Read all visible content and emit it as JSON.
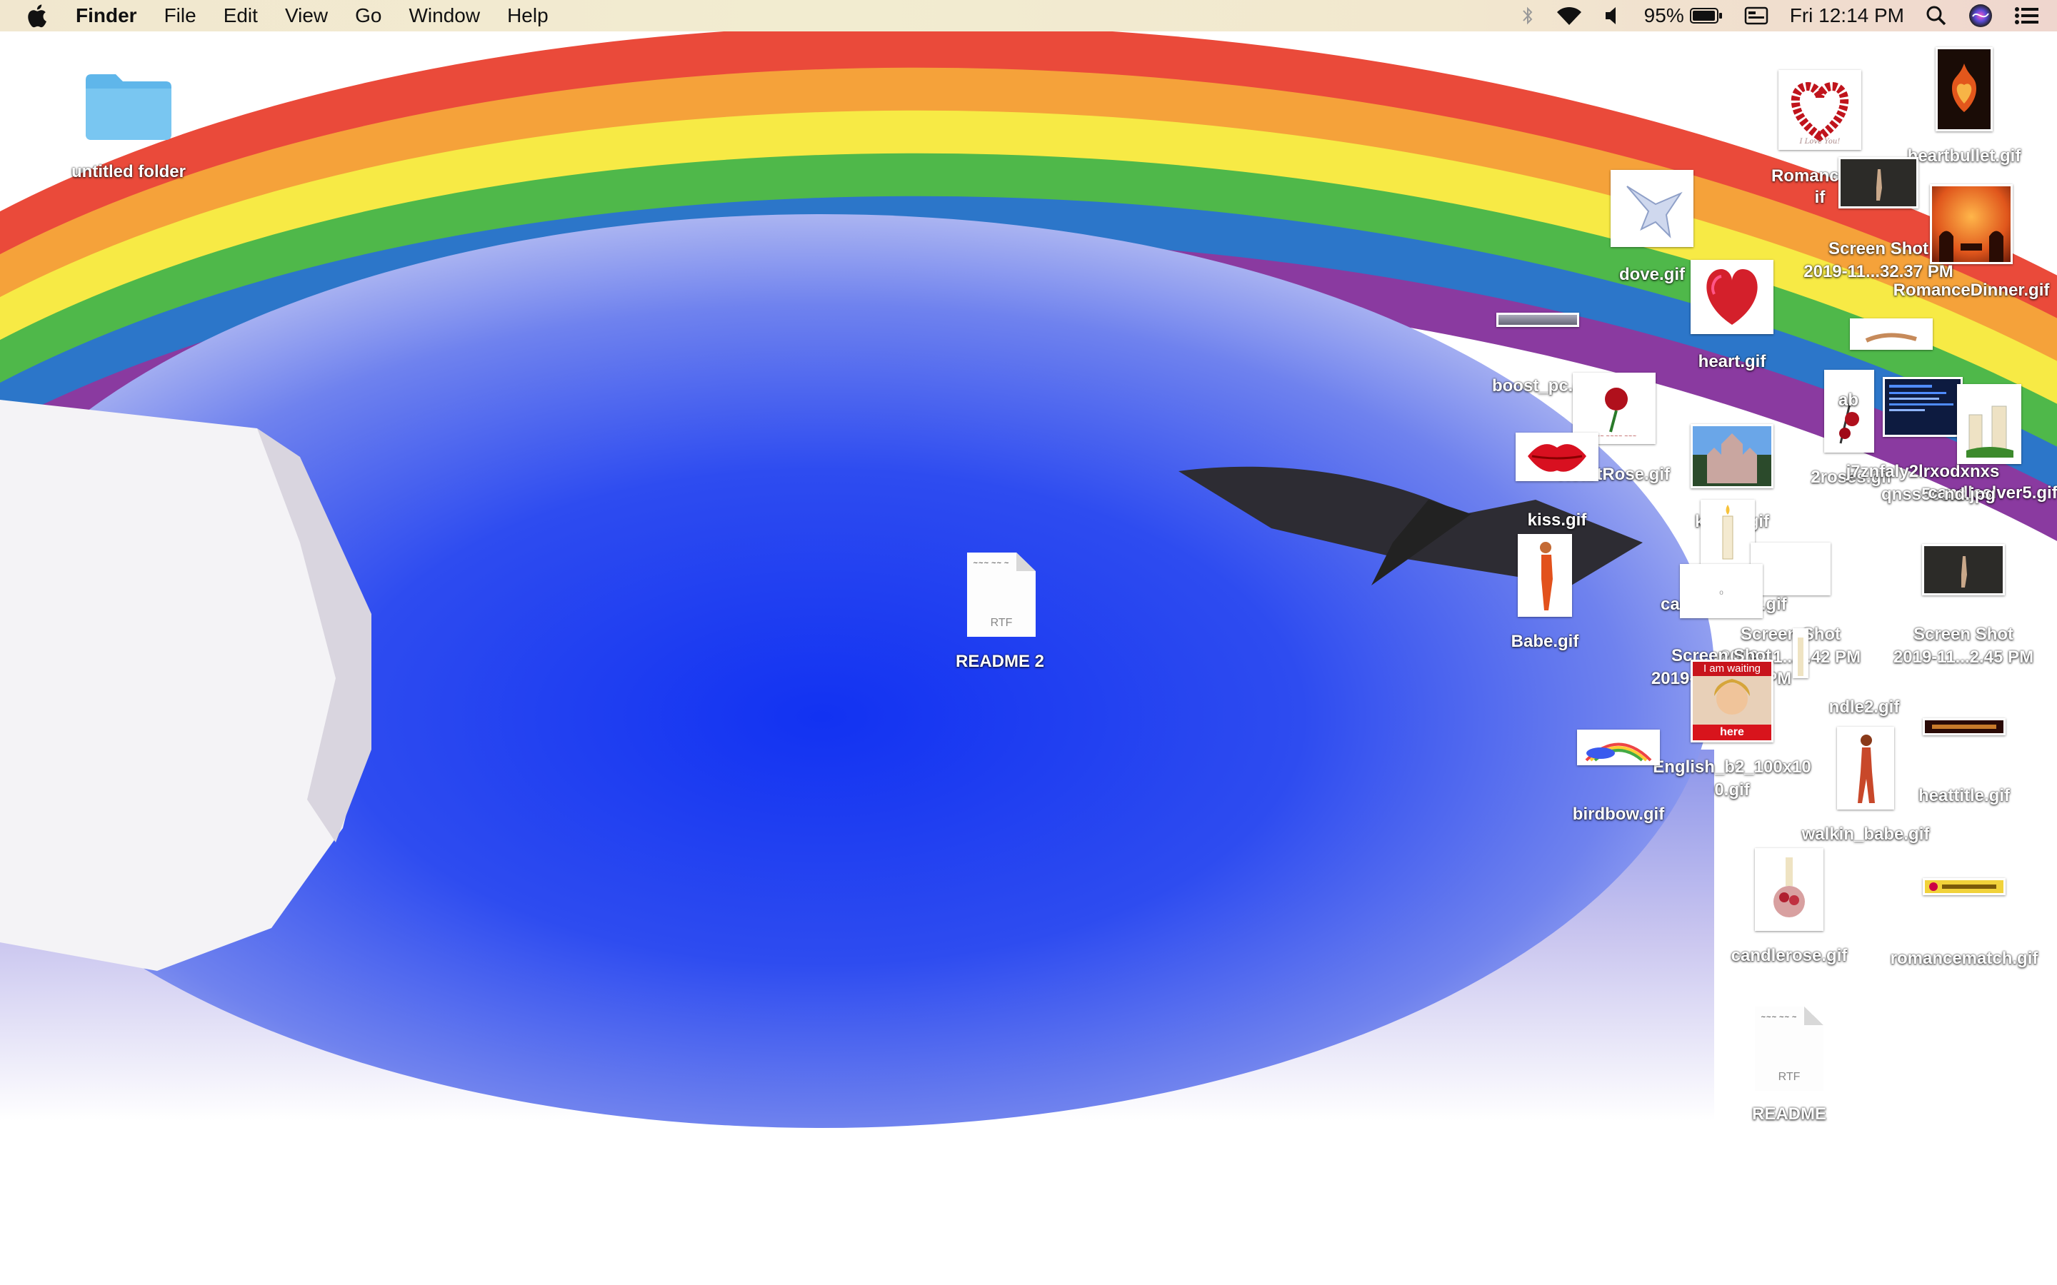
{
  "menubar": {
    "apple_icon": "apple-logo-icon",
    "app_name": "Finder",
    "menus": [
      "File",
      "Edit",
      "View",
      "Go",
      "Window",
      "Help"
    ],
    "status": {
      "bluetooth_icon": "bluetooth-icon",
      "wifi_icon": "wifi-icon",
      "volume_icon": "volume-icon",
      "battery_percent": "95%",
      "battery_icon": "battery-icon",
      "display_icon": "display-icon",
      "clock": "Fri 12:14 PM",
      "spotlight_icon": "search-icon",
      "siri_icon": "siri-icon",
      "notification_icon": "notification-center-icon"
    }
  },
  "desktop": {
    "icons": [
      {
        "label": "untitled folder",
        "kind": "folder"
      },
      {
        "label": "README 2",
        "kind": "rtf",
        "badge": "RTF"
      },
      {
        "label": "README",
        "kind": "rtf",
        "badge": "RTF"
      },
      {
        "label": "Romance_L",
        "label2": "if",
        "kind": "image"
      },
      {
        "label": "heartbullet.gif",
        "kind": "image"
      },
      {
        "label": "dove.gif",
        "kind": "image"
      },
      {
        "label": "Screen Shot",
        "label2": "2019-11...32.37 PM",
        "kind": "image"
      },
      {
        "label": "RomanceDinner.gif",
        "kind": "image"
      },
      {
        "label": "heart.gif",
        "kind": "image"
      },
      {
        "label": "boost_pc.g",
        "kind": "image"
      },
      {
        "label": "HeartRose.gif",
        "kind": "image"
      },
      {
        "label": "kiss.gif",
        "kind": "image"
      },
      {
        "label": "kastle.gif",
        "kind": "image"
      },
      {
        "label": "2roses.gif",
        "kind": "image"
      },
      {
        "label": "j7znfaly2lrxodxnxs",
        "label2": "qnss5ce.c",
        "kind": "image"
      },
      {
        "label": "candleslver5.gif",
        "kind": "image"
      },
      {
        "label": "ab",
        "kind": "image"
      },
      {
        "label": "nd.jpg",
        "kind": "image"
      },
      {
        "label": "Babe.gif",
        "kind": "image"
      },
      {
        "label": "car",
        "kind": "image"
      },
      {
        "label": "er.gif",
        "kind": "image"
      },
      {
        "label": "Screen Shot",
        "label2": "2019-11...6.42 PM",
        "kind": "image"
      },
      {
        "label": "Screen Shot",
        "label2": "2019-11...6.53 PM",
        "kind": "image"
      },
      {
        "label": "Screen Shot",
        "label2": "2019-11...2.45 PM",
        "kind": "image"
      },
      {
        "label": "ndle2.gif",
        "kind": "image"
      },
      {
        "label": "English_b2_100x10",
        "label2": "0.gif",
        "kind": "image",
        "thumb_top_text": "I am waiting",
        "thumb_bottom_text": "here"
      },
      {
        "label": "birdbow.gif",
        "kind": "image"
      },
      {
        "label": "walkin_babe.gif",
        "kind": "image"
      },
      {
        "label": "heattitle.gif",
        "kind": "image"
      },
      {
        "label": "candlerose.gif",
        "kind": "image"
      },
      {
        "label": "romancematch.gif",
        "kind": "image"
      }
    ]
  },
  "colors": {
    "rainbow": [
      "#ea4a3a",
      "#f5a23a",
      "#f7ea45",
      "#4fb84a",
      "#2c76c9",
      "#8a3aa0"
    ],
    "sky_blue": "#2442f0",
    "folder_blue": "#5fb6ea"
  }
}
